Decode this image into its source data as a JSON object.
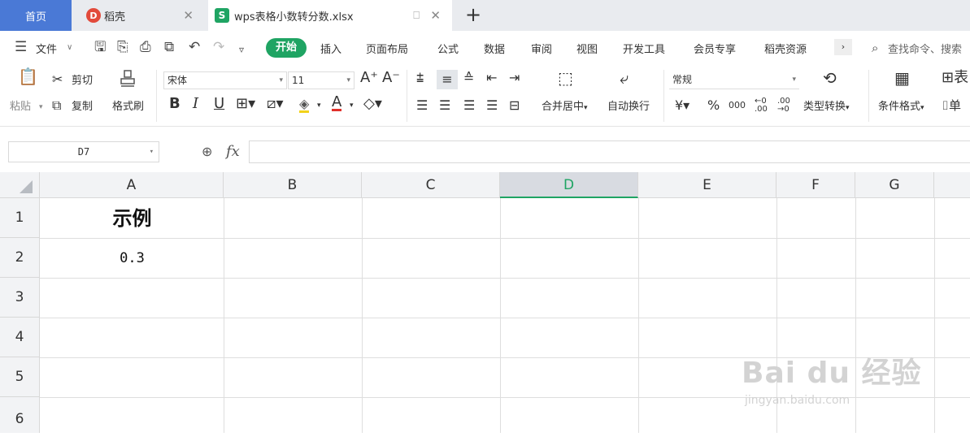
{
  "tabs": {
    "home": "首页",
    "daoke": "稻壳",
    "file": "wps表格小数转分数.xlsx"
  },
  "menu": {
    "file": "文件",
    "start": "开始",
    "items": [
      "插入",
      "页面布局",
      "公式",
      "数据",
      "审阅",
      "视图",
      "开发工具",
      "会员专享",
      "稻壳资源"
    ],
    "search": "查找命令、搜索"
  },
  "ribbon": {
    "paste": "粘贴",
    "cut": "剪切",
    "copy": "复制",
    "format_painter": "格式刷",
    "font_name": "宋体",
    "font_size": "11",
    "bold": "B",
    "italic": "I",
    "underline": "U",
    "merge_center": "合并居中",
    "wrap_text": "自动换行",
    "number_format": "常规",
    "type_convert": "类型转换",
    "conditional_format": "条件格式",
    "table_style": "表",
    "cell": "单"
  },
  "formula_bar": {
    "name_box": "D7",
    "fx": "fx",
    "value": ""
  },
  "grid": {
    "columns": [
      "A",
      "B",
      "C",
      "D",
      "E",
      "F",
      "G"
    ],
    "selected_column": "D",
    "rows": [
      "1",
      "2",
      "3",
      "4",
      "5",
      "6"
    ],
    "cells": {
      "A1": "示例",
      "A2": "0.3"
    }
  },
  "watermark": {
    "brand": "Bai du 经验",
    "url": "jingyan.baidu.com"
  }
}
